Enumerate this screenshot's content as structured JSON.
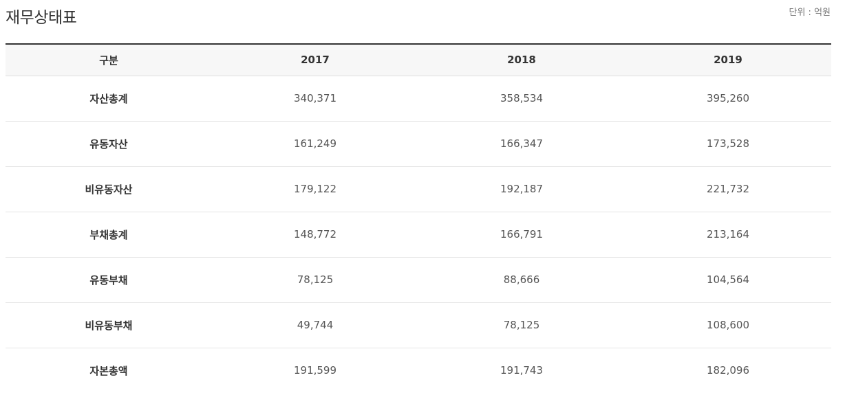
{
  "page": {
    "title": "재무상태표",
    "unit": "단위 : 억원"
  },
  "table": {
    "headers": [
      "구분",
      "2017",
      "2018",
      "2019"
    ],
    "rows": [
      {
        "label": "자산총계",
        "values": [
          "340,371",
          "358,534",
          "395,260"
        ]
      },
      {
        "label": "유동자산",
        "values": [
          "161,249",
          "166,347",
          "173,528"
        ]
      },
      {
        "label": "비유동자산",
        "values": [
          "179,122",
          "192,187",
          "221,732"
        ]
      },
      {
        "label": "부채총계",
        "values": [
          "148,772",
          "166,791",
          "213,164"
        ]
      },
      {
        "label": "유동부채",
        "values": [
          "78,125",
          "88,666",
          "104,564"
        ]
      },
      {
        "label": "비유동부채",
        "values": [
          "49,744",
          "78,125",
          "108,600"
        ]
      },
      {
        "label": "자본총액",
        "values": [
          "191,599",
          "191,743",
          "182,096"
        ]
      }
    ]
  }
}
